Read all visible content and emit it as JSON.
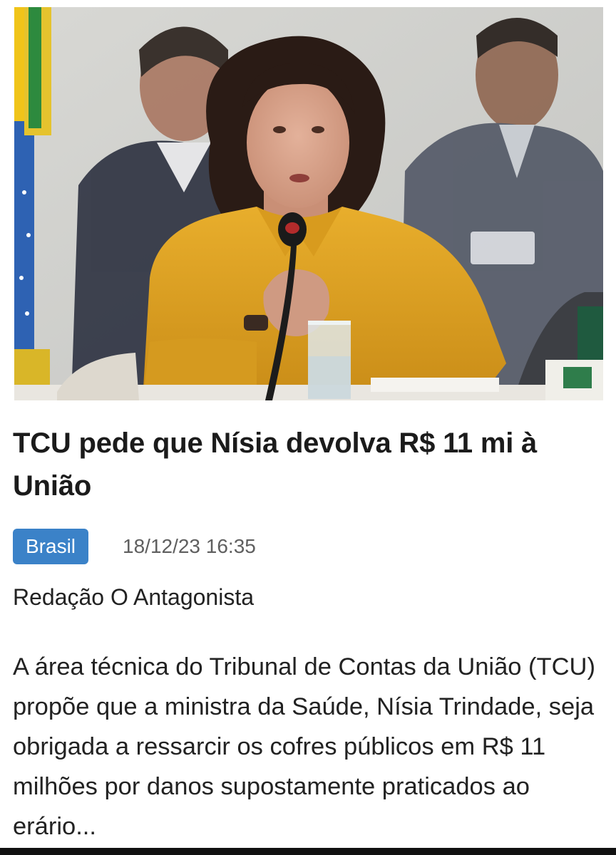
{
  "article": {
    "image_alt": "Photo of a woman in a mustard yellow blouse speaking into a microphone at a hearing",
    "headline": "TCU pede que Nísia devolva R$ 11 mi à União",
    "category": "Brasil",
    "timestamp": "18/12/23 16:35",
    "author": "Redação O Antagonista",
    "summary": "A área técnica do Tribunal de Contas da União (TCU) propõe que a ministra da Saúde, Nísia Trindade, seja obrigada a ressarcir os cofres públicos em R$ 11 milhões por danos supostamente praticados ao erário..."
  },
  "colors": {
    "badge_background": "#3b82c8",
    "badge_text": "#ffffff",
    "headline_text": "#1b1b1b",
    "meta_text": "#5f5f5f",
    "body_text": "#222222"
  }
}
